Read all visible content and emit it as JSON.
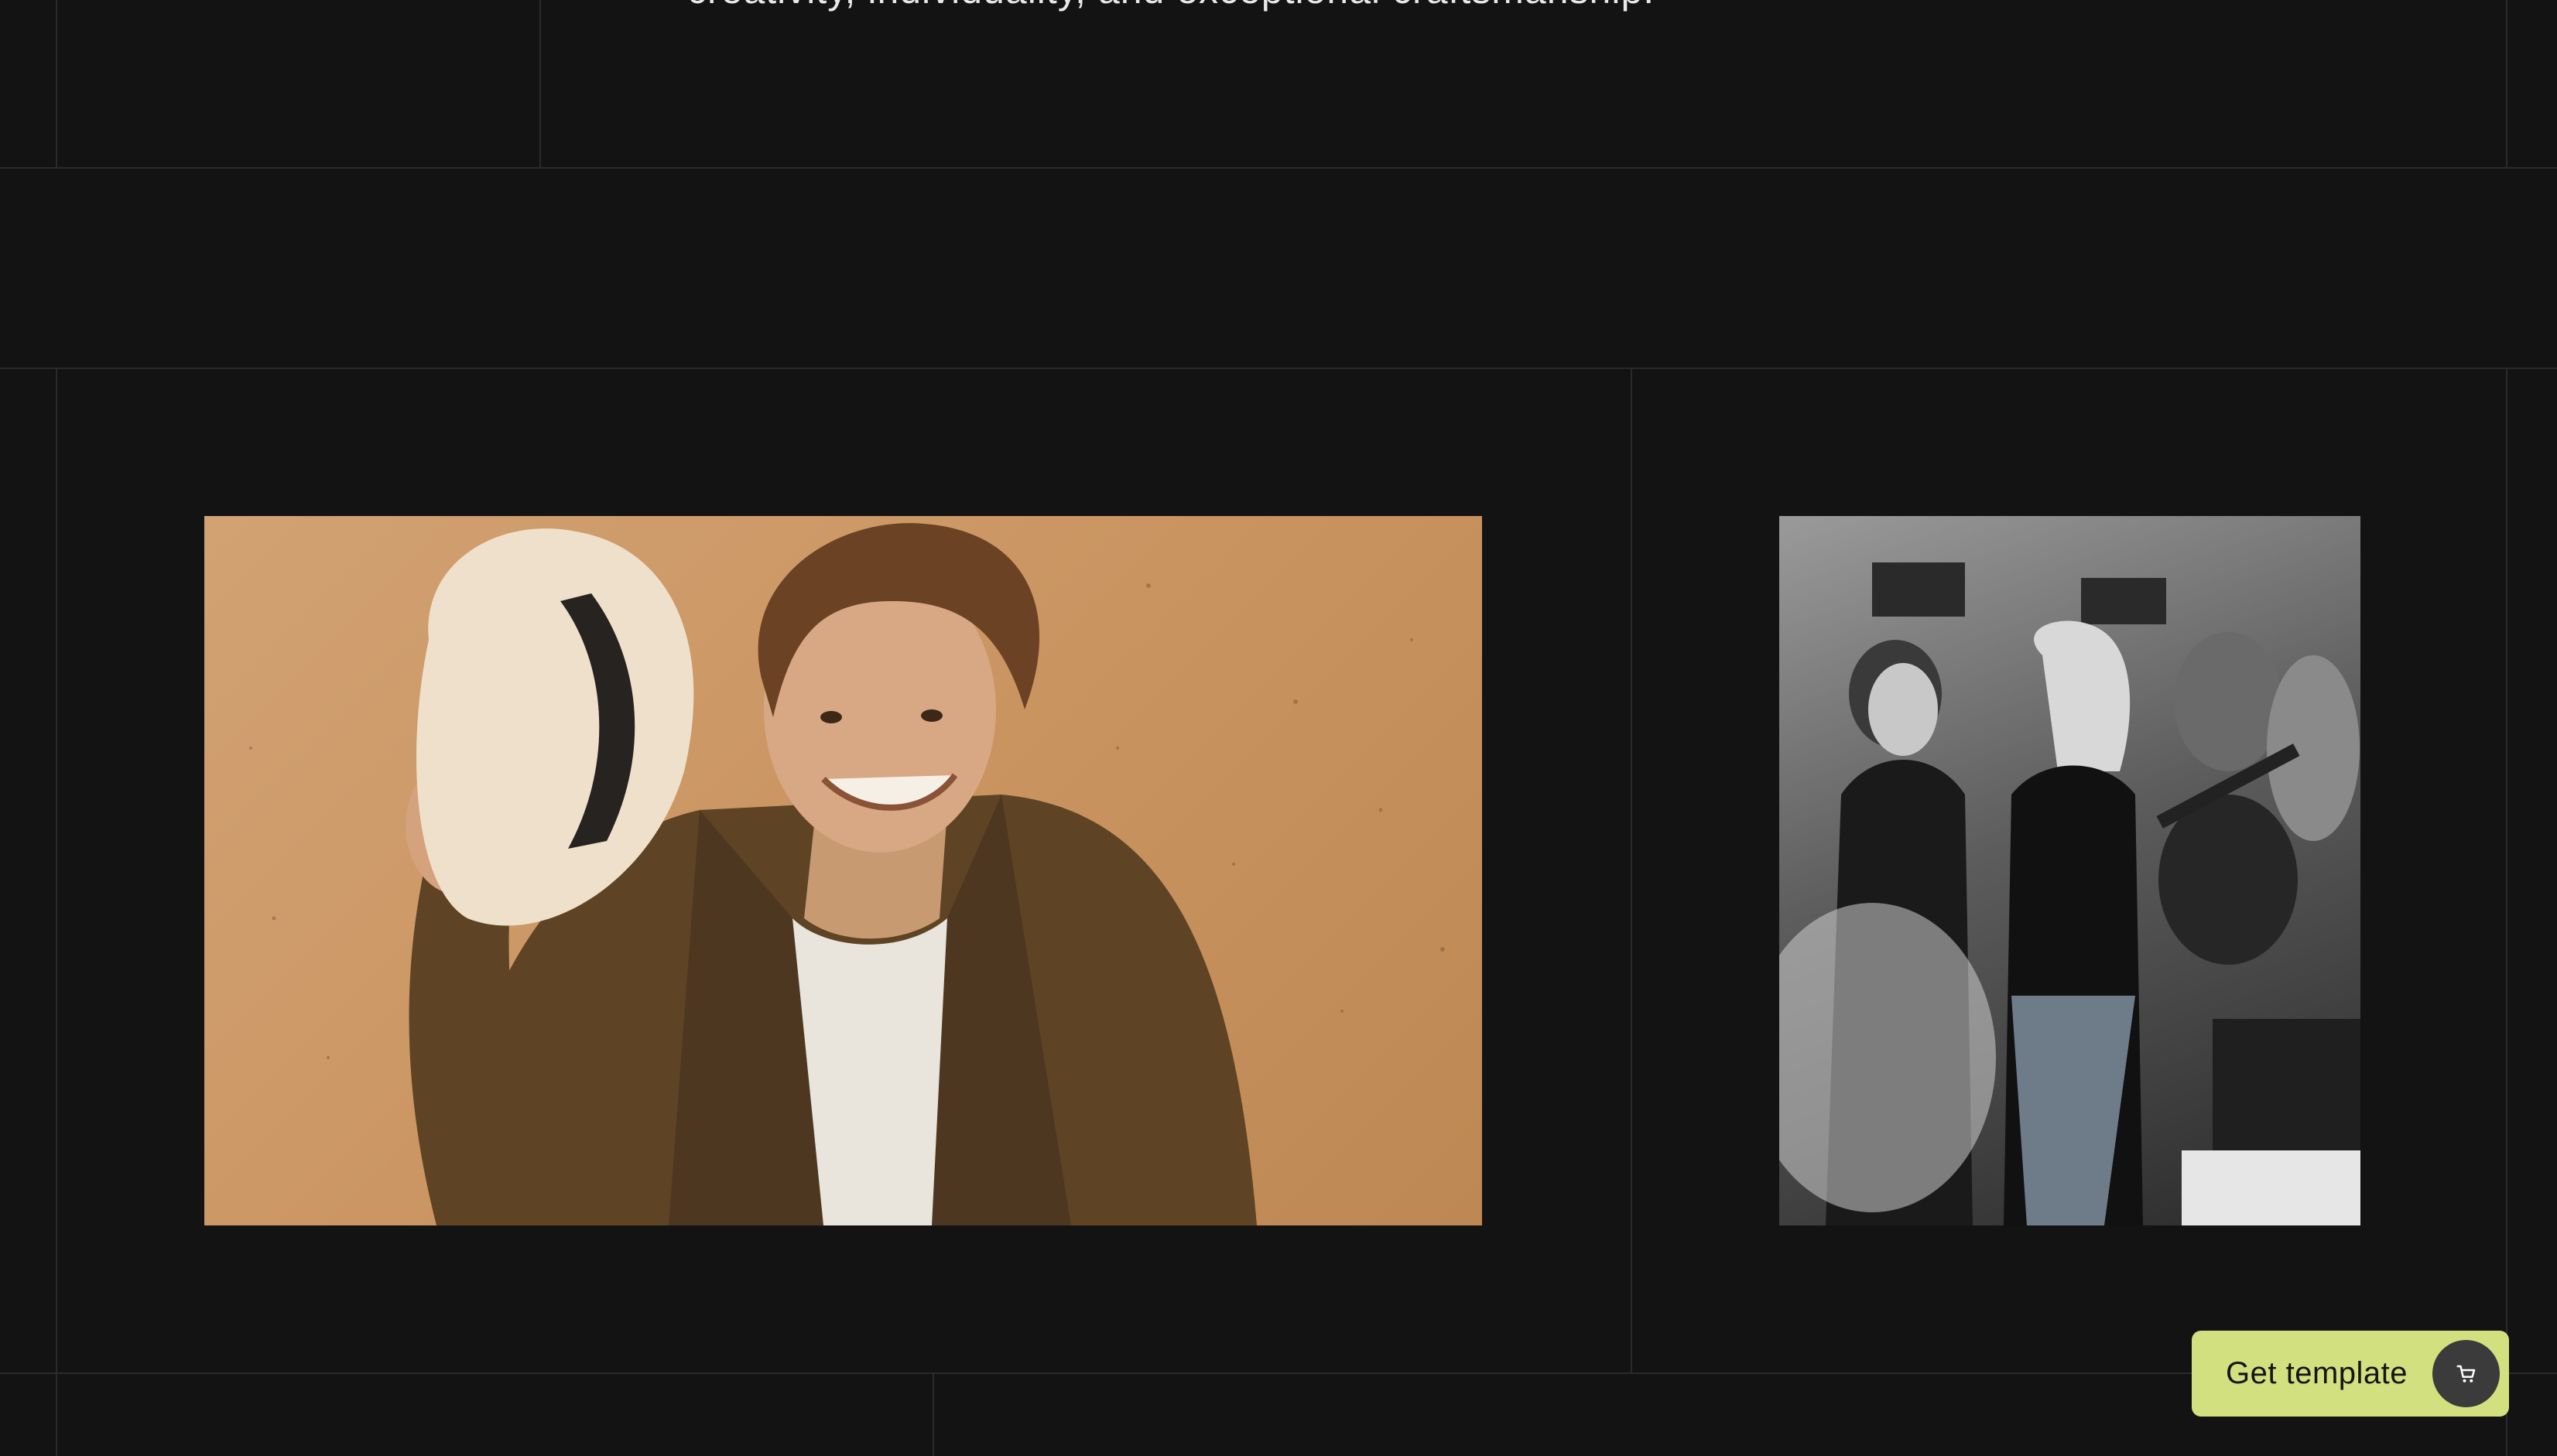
{
  "intro": {
    "text": "creativity, individuality, and exceptional craftsmanship."
  },
  "gallery": {
    "portrait_alt": "Smiling man holding a straw fedora hat",
    "salon_alt": "Hair stylists curling hair at a salon event"
  },
  "cta": {
    "label": "Get template",
    "icon": "cart-icon"
  },
  "colors": {
    "background": "#131313",
    "grid_line": "#2b2b2b",
    "cta_background": "#d3e07f",
    "cta_icon_background": "#3b3b3b",
    "text": "#e8e8e8"
  }
}
